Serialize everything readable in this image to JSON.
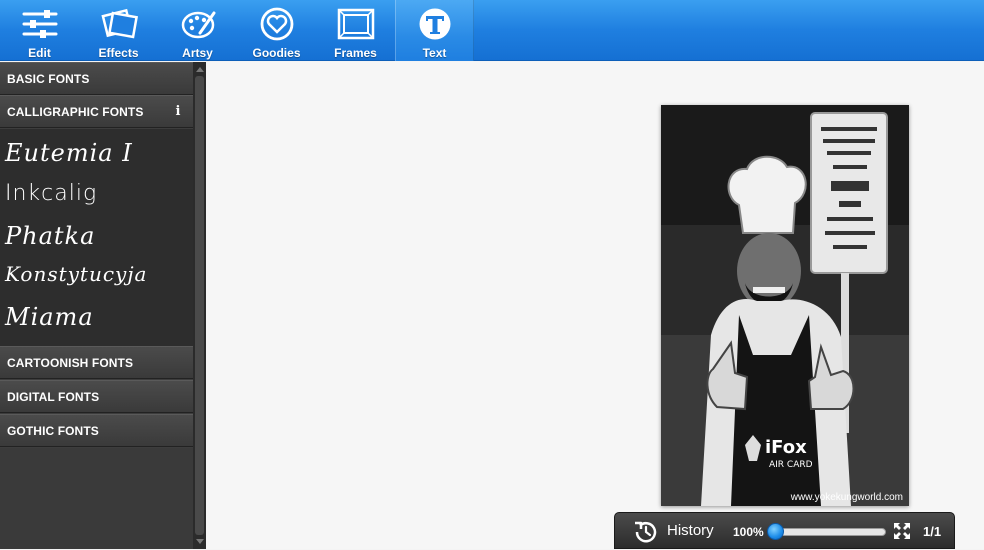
{
  "toolbar": {
    "items": [
      {
        "label": "Edit",
        "icon": "sliders-icon"
      },
      {
        "label": "Effects",
        "icon": "photos-icon"
      },
      {
        "label": "Artsy",
        "icon": "palette-icon"
      },
      {
        "label": "Goodies",
        "icon": "heart-badge-icon"
      },
      {
        "label": "Frames",
        "icon": "frame-icon"
      },
      {
        "label": "Text",
        "icon": "text-t-icon"
      }
    ],
    "active": "Text"
  },
  "sidebar": {
    "categories": {
      "basic": "BASIC FONTS",
      "calligraphic": "CALLIGRAPHIC FONTS",
      "cartoonish": "CARTOONISH FONTS",
      "digital": "DIGITAL FONTS",
      "gothic": "GOTHIC FONTS"
    },
    "calligraphic_fonts": [
      "Eutemia I",
      "Inkcalig",
      "Phatka",
      "Konstytucyja",
      "Miama"
    ]
  },
  "photo": {
    "watermark": "www.yokekungworld.com"
  },
  "history_bar": {
    "label": "History",
    "zoom": "100%",
    "zoom_fraction": 0.0,
    "page": "1/1"
  },
  "colors": {
    "toolbar_blue": "#1f7fe0",
    "sidebar_dark": "#3d3d3d",
    "accent_knob": "#1b8be8"
  }
}
